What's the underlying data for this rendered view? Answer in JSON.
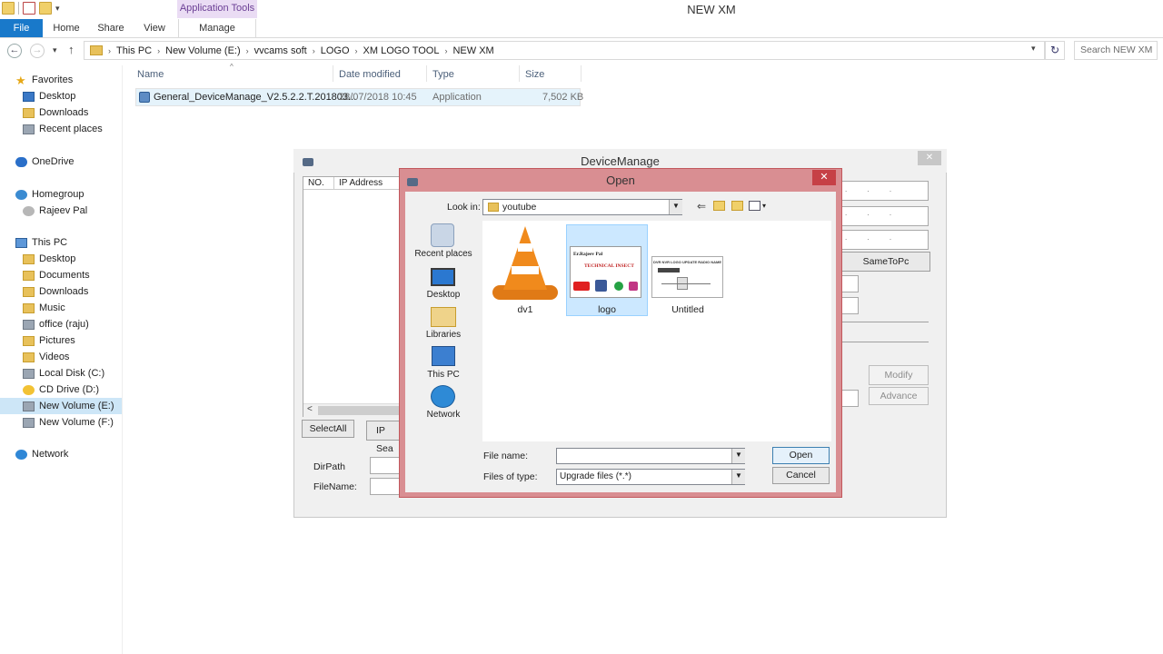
{
  "window": {
    "title": "NEW XM",
    "context_tab": "Application Tools",
    "ribbon_tabs": [
      "File",
      "Home",
      "Share",
      "View",
      "Manage"
    ]
  },
  "address": {
    "crumbs": [
      "This PC",
      "New Volume (E:)",
      "vvcams soft",
      "LOGO",
      "XM LOGO TOOL",
      "NEW XM"
    ],
    "search_placeholder": "Search NEW XM"
  },
  "sidebar": {
    "items": [
      {
        "label": "Favorites",
        "icon": "star-icon"
      },
      {
        "label": "Desktop",
        "icon": "desktop-icon"
      },
      {
        "label": "Downloads",
        "icon": "downloads-folder-icon"
      },
      {
        "label": "Recent places",
        "icon": "recent-places-icon"
      },
      {
        "label": "OneDrive",
        "icon": "onedrive-icon"
      },
      {
        "label": "Homegroup",
        "icon": "homegroup-icon"
      },
      {
        "label": "Rajeev Pal",
        "icon": "user-icon"
      },
      {
        "label": "This PC",
        "icon": "this-pc-icon"
      },
      {
        "label": "Desktop",
        "icon": "desktop-folder-icon"
      },
      {
        "label": "Documents",
        "icon": "documents-folder-icon"
      },
      {
        "label": "Downloads",
        "icon": "downloads-folder-icon"
      },
      {
        "label": "Music",
        "icon": "music-folder-icon"
      },
      {
        "label": "office (raju)",
        "icon": "network-drive-icon"
      },
      {
        "label": "Pictures",
        "icon": "pictures-folder-icon"
      },
      {
        "label": "Videos",
        "icon": "videos-folder-icon"
      },
      {
        "label": "Local Disk (C:)",
        "icon": "local-disk-icon"
      },
      {
        "label": "CD Drive (D:)",
        "icon": "cd-drive-icon"
      },
      {
        "label": "New Volume (E:)",
        "icon": "drive-icon"
      },
      {
        "label": "New Volume (F:)",
        "icon": "drive-icon"
      },
      {
        "label": "Network",
        "icon": "network-icon"
      }
    ]
  },
  "filelist": {
    "columns": [
      "Name",
      "Date modified",
      "Type",
      "Size"
    ],
    "rows": [
      {
        "name": "General_DeviceManage_V2.5.2.2.T.201803...",
        "date": "28/07/2018 10:45",
        "type": "Application",
        "size": "7,502 KB"
      }
    ]
  },
  "devicemanage": {
    "title": "DeviceManage",
    "close": "✕",
    "list_columns": [
      "NO.",
      "IP Address"
    ],
    "select_all": "SelectAll",
    "ip_search": "IP Sea",
    "dirpath_label": "DirPath",
    "filename_label": "FileName:",
    "same_to_pc": "SameToPc",
    "modify": "Modify",
    "advance": "Advance"
  },
  "open_dialog": {
    "title": "Open",
    "close": "✕",
    "look_in_label": "Look in:",
    "look_in_value": "youtube",
    "places": [
      "Recent places",
      "Desktop",
      "Libraries",
      "This PC",
      "Network"
    ],
    "items": [
      {
        "label": "dv1",
        "icon": "vlc-cone-icon"
      },
      {
        "label": "logo",
        "icon": "image-thumbnail"
      },
      {
        "label": "Untitled",
        "icon": "image-thumbnail"
      }
    ],
    "logo_thumb": {
      "line1": "Er.Rajeev Pal",
      "line2": "TECHNICAL INSECT"
    },
    "untitled_thumb": {
      "line1": "DVR NVR LOGO UPDATE RADIO NAME"
    },
    "file_name_label": "File name:",
    "file_name_value": "",
    "files_of_type_label": "Files of type:",
    "files_of_type_value": "Upgrade files (*.*)",
    "open_button": "Open",
    "cancel_button": "Cancel"
  },
  "colors": {
    "file_tab": "#1979ca",
    "context_tab_bg": "#eadcf4",
    "dialog_frame": "#d98e92",
    "dialog_close": "#c64046",
    "selection": "#cce8ff"
  }
}
